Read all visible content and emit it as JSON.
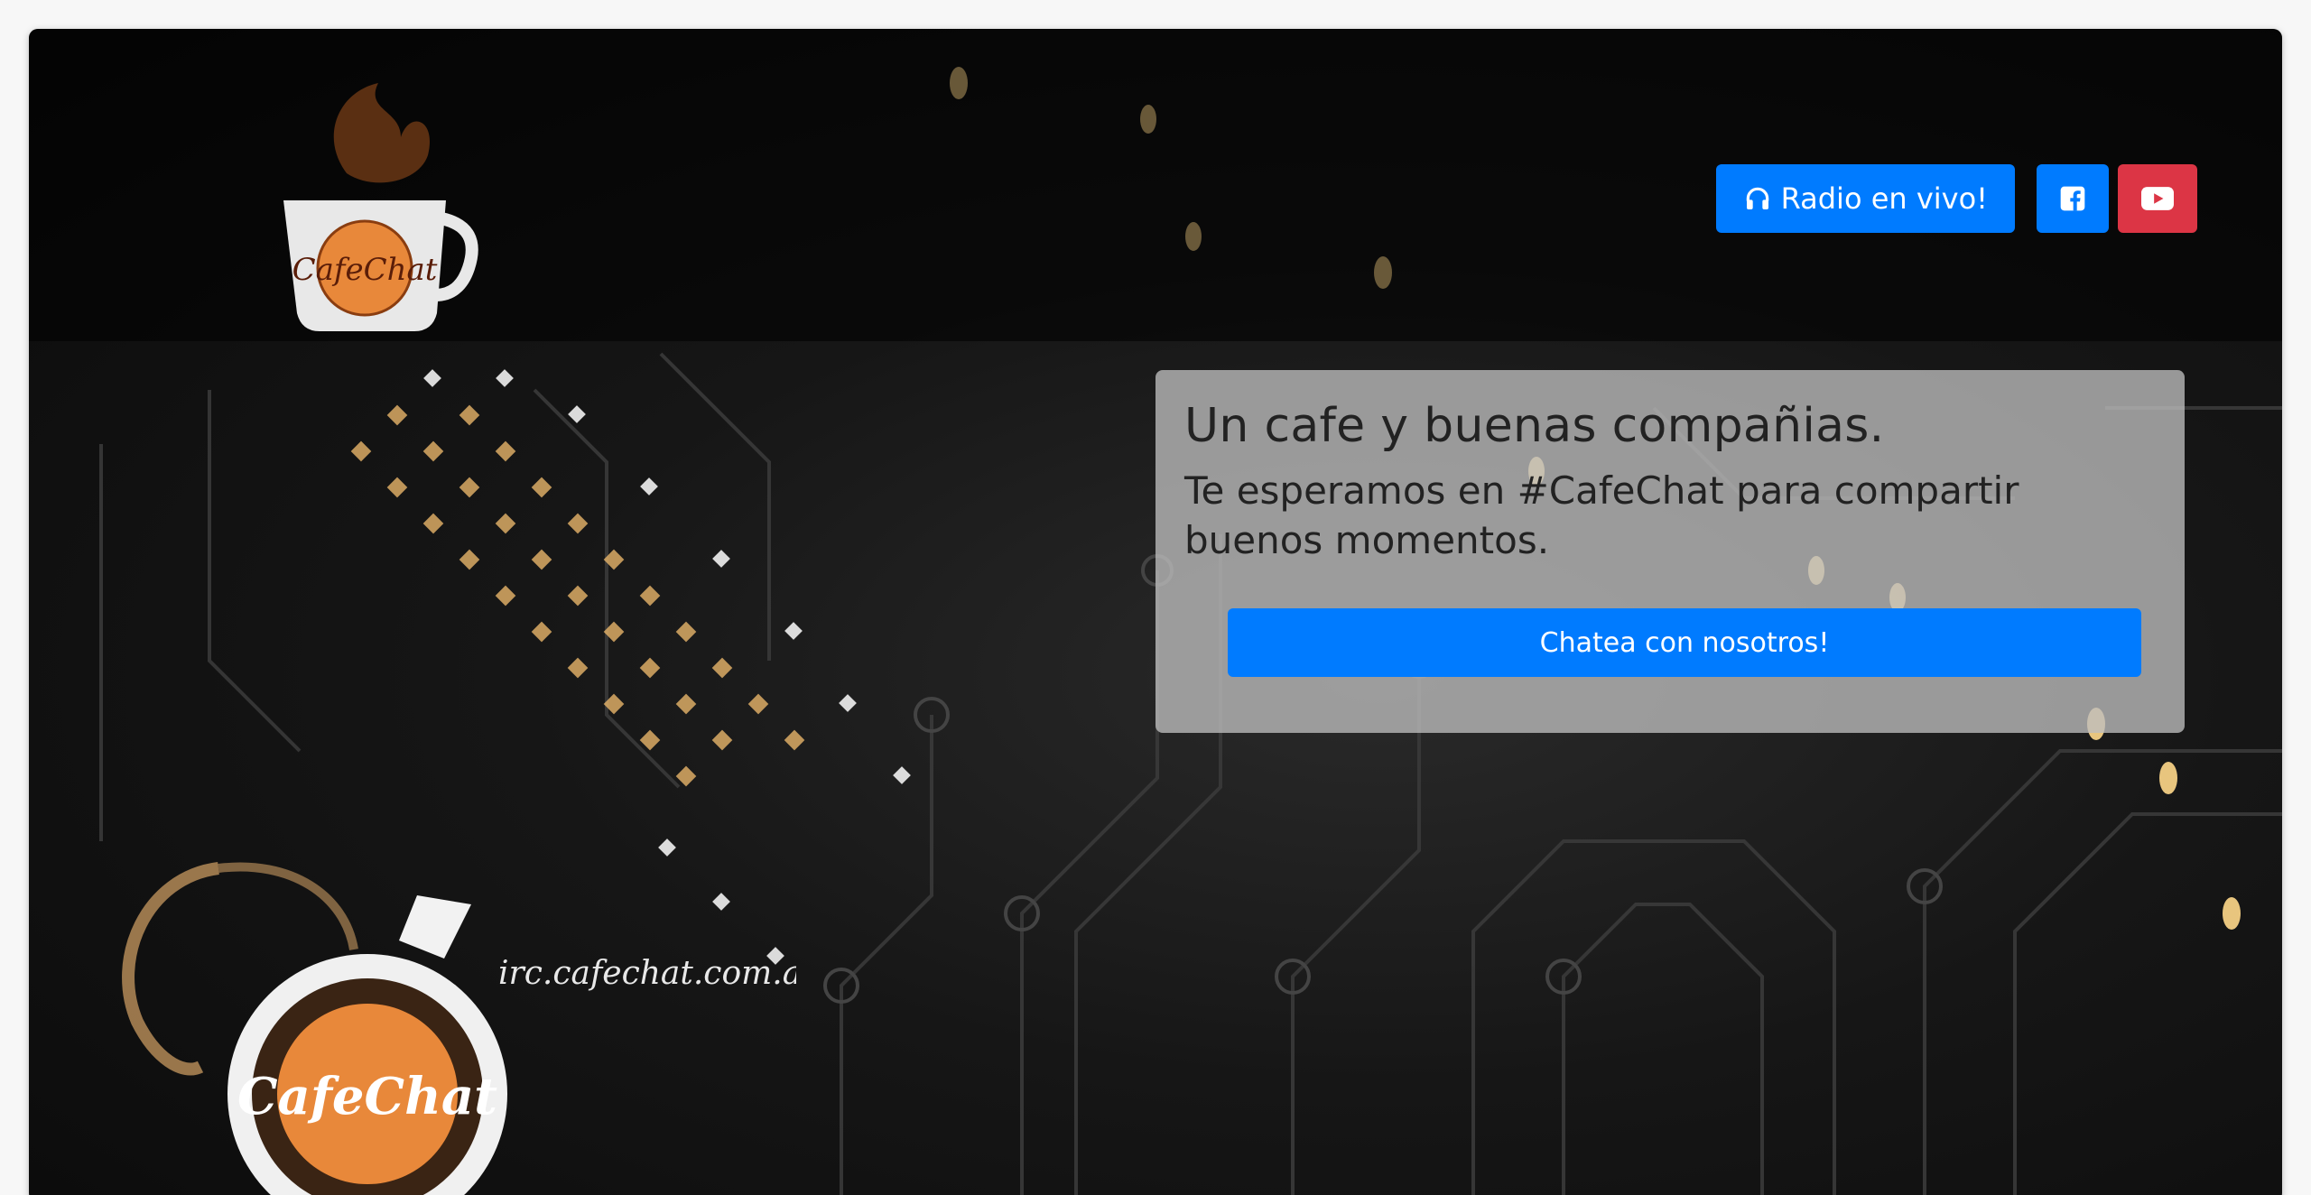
{
  "nav": {
    "radio_label": "Radio en vivo!",
    "facebook_icon": "facebook-square-icon",
    "youtube_icon": "youtube-icon"
  },
  "logo": {
    "text": "CafeChat"
  },
  "hero": {
    "title": "Un cafe y buenas compañias.",
    "subtitle": "Te esperamos en #CafeChat para compartir buenos momentos.",
    "cta_label": "Chatea con nosotros!"
  },
  "stamp": {
    "logo_text": "CafeChat",
    "url_text": "irc.cafechat.com.ar"
  },
  "colors": {
    "primary": "#007bff",
    "danger": "#dc3545",
    "card": "#bebebe"
  }
}
